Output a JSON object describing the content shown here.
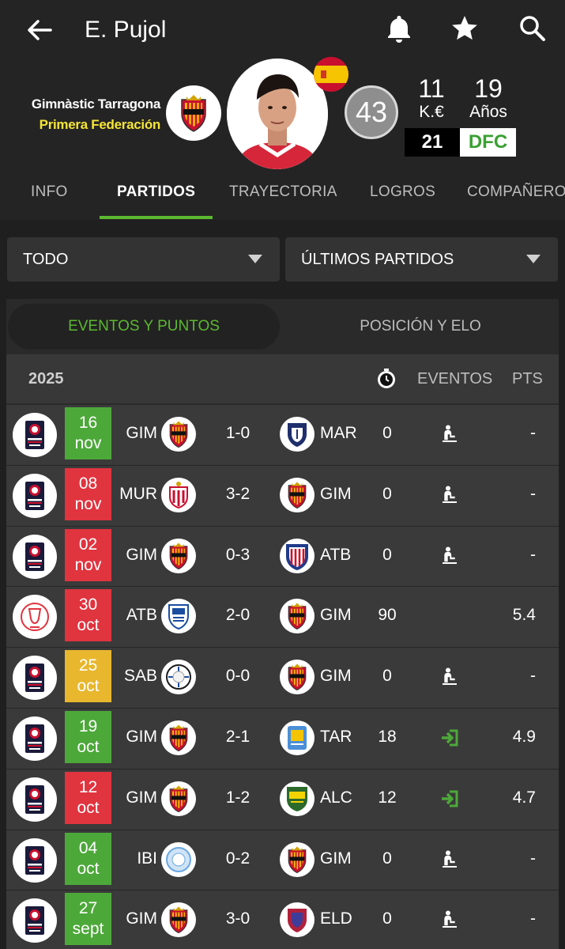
{
  "header": {
    "title": "E. Pujol"
  },
  "profile": {
    "team": "Gimnàstic Tarragona",
    "league": "Primera Federación",
    "rating": "43",
    "value": "11",
    "value_unit": "K.€",
    "age": "19",
    "age_unit": "Años",
    "number": "21",
    "position": "DFC"
  },
  "tabs": [
    "INFO",
    "PARTIDOS",
    "TRAYECTORIA",
    "LOGROS",
    "COMPAÑEROS"
  ],
  "filters": {
    "competition": "TODO",
    "range": "ÚLTIMOS PARTIDOS"
  },
  "segments": {
    "events": "EVENTOS Y PUNTOS",
    "position": "POSICIÓN Y ELO"
  },
  "list_header": {
    "year": "2025",
    "events": "EVENTOS",
    "pts": "PTS"
  },
  "matches": [
    {
      "day": "16",
      "month": "nov",
      "result": "green",
      "home": "GIM",
      "score": "1-0",
      "away": "MAR",
      "mins": "0",
      "event": "bench",
      "pts": "-"
    },
    {
      "day": "08",
      "month": "nov",
      "result": "red",
      "home": "MUR",
      "score": "3-2",
      "away": "GIM",
      "mins": "0",
      "event": "bench",
      "pts": "-"
    },
    {
      "day": "02",
      "month": "nov",
      "result": "red",
      "home": "GIM",
      "score": "0-3",
      "away": "ATB",
      "mins": "0",
      "event": "bench",
      "pts": "-"
    },
    {
      "day": "30",
      "month": "oct",
      "result": "red",
      "home": "ATB",
      "score": "2-0",
      "away": "GIM",
      "mins": "90",
      "event": "none",
      "pts": "5.4"
    },
    {
      "day": "25",
      "month": "oct",
      "result": "yellow",
      "home": "SAB",
      "score": "0-0",
      "away": "GIM",
      "mins": "0",
      "event": "bench",
      "pts": "-"
    },
    {
      "day": "19",
      "month": "oct",
      "result": "green",
      "home": "GIM",
      "score": "2-1",
      "away": "TAR",
      "mins": "18",
      "event": "sub-in",
      "pts": "4.9"
    },
    {
      "day": "12",
      "month": "oct",
      "result": "red",
      "home": "GIM",
      "score": "1-2",
      "away": "ALC",
      "mins": "12",
      "event": "sub-in",
      "pts": "4.7"
    },
    {
      "day": "04",
      "month": "oct",
      "result": "green",
      "home": "IBI",
      "score": "0-2",
      "away": "GIM",
      "mins": "0",
      "event": "bench",
      "pts": "-"
    },
    {
      "day": "27",
      "month": "sept",
      "result": "green",
      "home": "GIM",
      "score": "3-0",
      "away": "ELD",
      "mins": "0",
      "event": "bench",
      "pts": "-"
    }
  ],
  "colors": {
    "accent": "#5cb82f",
    "league": "#f5e536",
    "win": "#4da83a",
    "loss": "#e0343f",
    "draw": "#e8b72e"
  }
}
